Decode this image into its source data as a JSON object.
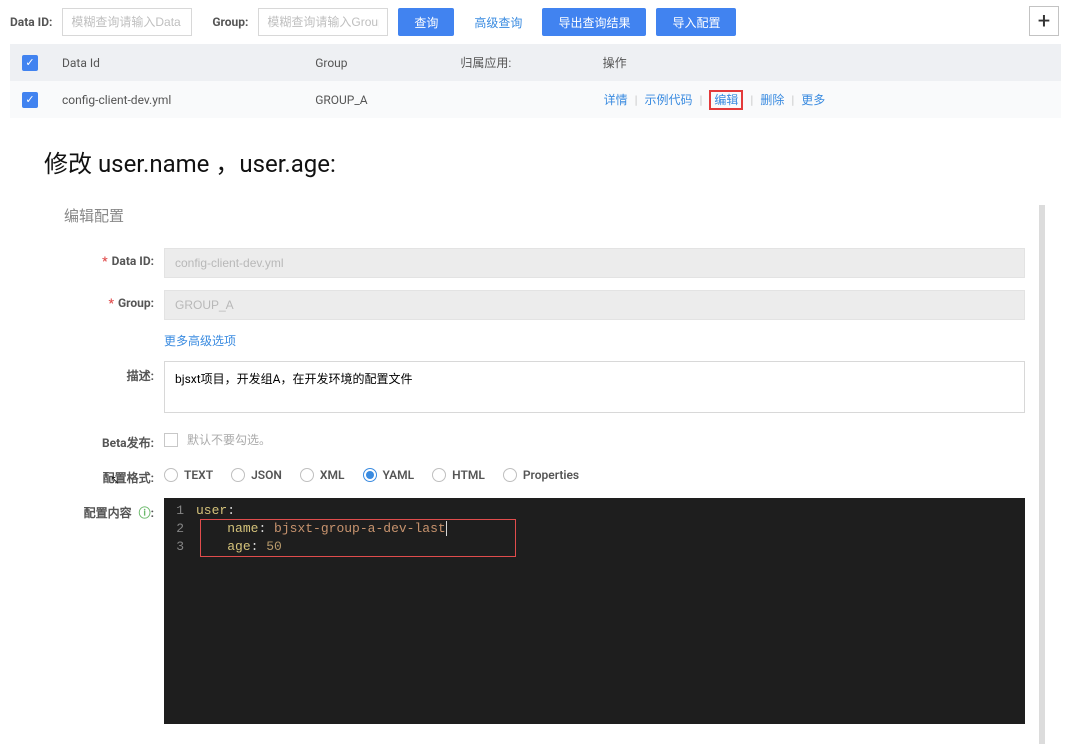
{
  "search": {
    "label_data_id": "Data ID:",
    "ph_data_id": "模糊查询请输入Data ID",
    "label_group": "Group:",
    "ph_group": "模糊查询请输入Group",
    "btn_query": "查询",
    "btn_adv": "高级查询",
    "btn_export": "导出查询结果",
    "btn_import": "导入配置"
  },
  "table": {
    "headers": {
      "data_id": "Data Id",
      "group": "Group",
      "app": "归属应用:",
      "ops": "操作"
    },
    "rows": [
      {
        "data_id": "config-client-dev.yml",
        "group": "GROUP_A",
        "app": ""
      }
    ],
    "actions": {
      "detail": "详情",
      "sample": "示例代码",
      "edit": "编辑",
      "delete": "删除",
      "more": "更多"
    }
  },
  "mid_heading": "修改 user.name  ，user.age:",
  "form": {
    "title": "编辑配置",
    "labels": {
      "data_id": "Data ID:",
      "group": "Group:",
      "adv_link": "更多高级选项",
      "desc": "描述:",
      "beta": "Beta发布:",
      "beta_note": "默认不要勾选。",
      "format": "配置格式:",
      "content": "配置内容"
    },
    "values": {
      "data_id": "config-client-dev.yml",
      "group": "GROUP_A",
      "desc": "bjsxt项目，开发组A，在开发环境的配置文件"
    },
    "formats": [
      "TEXT",
      "JSON",
      "XML",
      "YAML",
      "HTML",
      "Properties"
    ],
    "format_selected": "YAML",
    "editor_lines": [
      {
        "n": 1,
        "k": "user",
        "c": ":"
      },
      {
        "n": 2,
        "indent": "    ",
        "k": "name",
        "c": ": ",
        "v": "bjsxt-group-a-dev-last",
        "vtype": "str",
        "cursor": true
      },
      {
        "n": 3,
        "indent": "    ",
        "k": "age",
        "c": ": ",
        "v": "50",
        "vtype": "num"
      }
    ]
  }
}
